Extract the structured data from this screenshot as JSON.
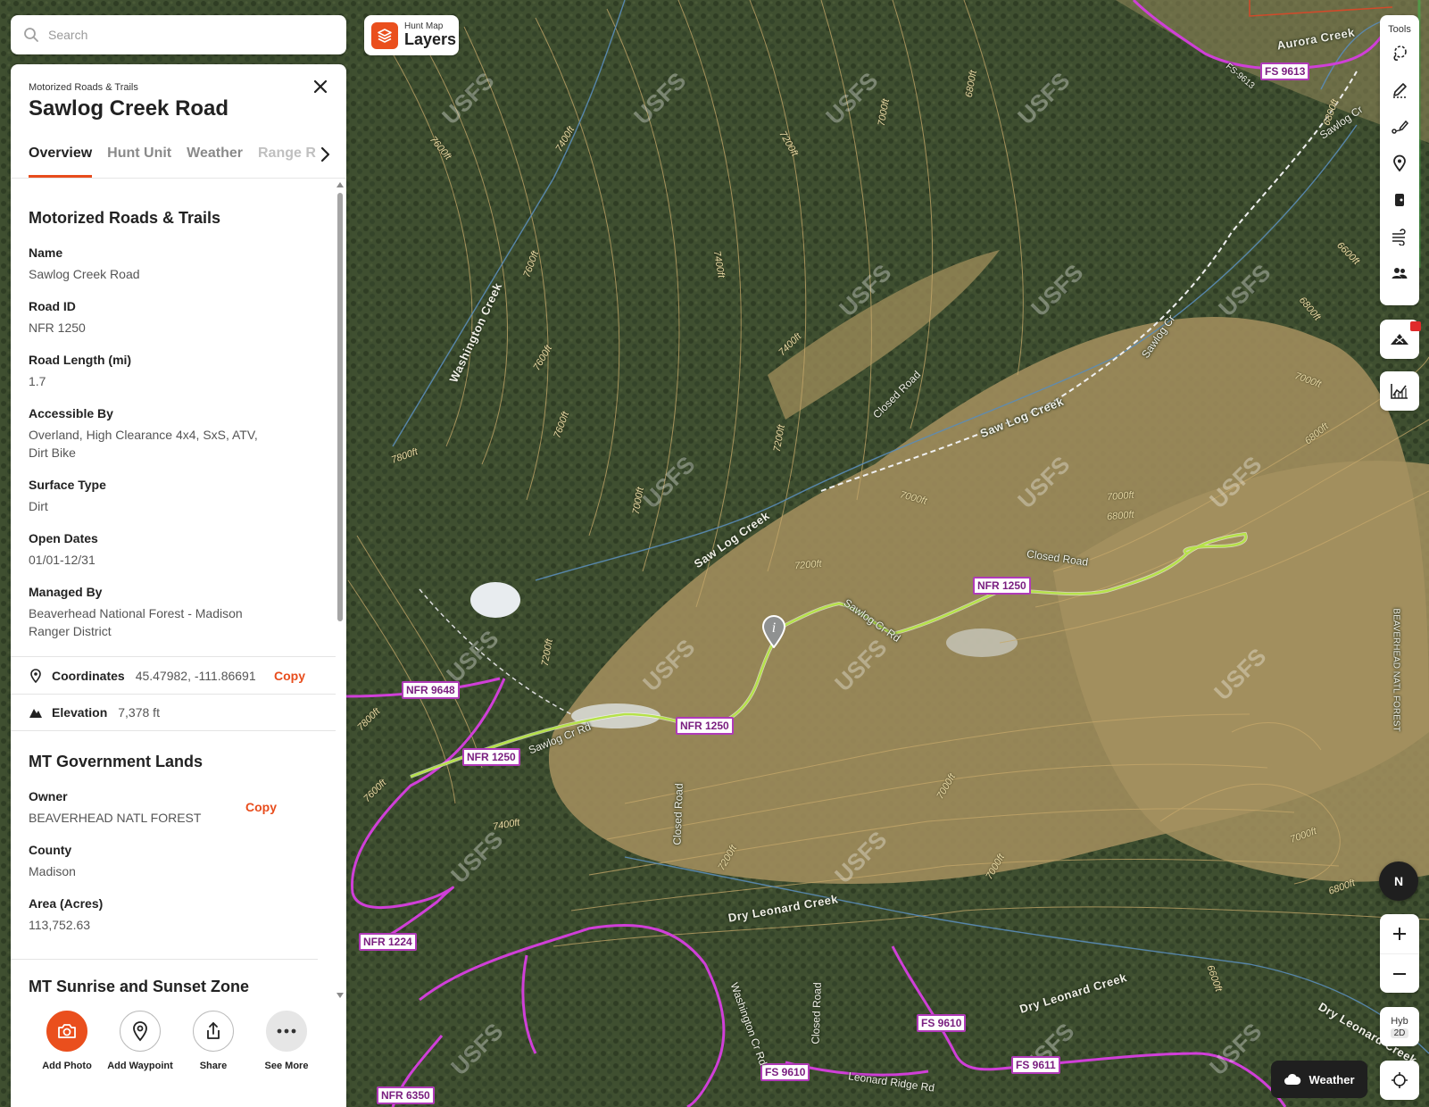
{
  "search": {
    "placeholder": "Search"
  },
  "layers": {
    "small": "Hunt Map",
    "label": "Layers"
  },
  "panel": {
    "subtitle": "Motorized Roads & Trails",
    "title": "Sawlog Creek Road",
    "tabs": [
      "Overview",
      "Hunt Unit",
      "Weather",
      "Range Rac"
    ],
    "section1_title": "Motorized Roads & Trails",
    "fields": [
      {
        "label": "Name",
        "value": "Sawlog Creek Road"
      },
      {
        "label": "Road ID",
        "value": "NFR 1250"
      },
      {
        "label": "Road Length (mi)",
        "value": "1.7"
      },
      {
        "label": "Accessible By",
        "value": "Overland, High Clearance 4x4, SxS, ATV, Dirt Bike"
      },
      {
        "label": "Surface Type",
        "value": "Dirt"
      },
      {
        "label": "Open Dates",
        "value": "01/01-12/31"
      },
      {
        "label": "Managed By",
        "value": "Beaverhead National Forest - Madison Ranger District"
      }
    ],
    "coordinates": {
      "label": "Coordinates",
      "value": "45.47982, -111.86691",
      "copy": "Copy"
    },
    "elevation": {
      "label": "Elevation",
      "value": "7,378 ft"
    },
    "section2_title": "MT Government Lands",
    "gov_fields": [
      {
        "label": "Owner",
        "value": "BEAVERHEAD NATL FOREST"
      },
      {
        "label": "County",
        "value": "Madison"
      },
      {
        "label": "Area (Acres)",
        "value": "113,752.63"
      }
    ],
    "owner_copy": "Copy",
    "section3_title": "MT Sunrise and Sunset Zone",
    "actions": [
      "Add Photo",
      "Add Waypoint",
      "Share",
      "See More"
    ]
  },
  "toolbar": {
    "label": "Tools",
    "tools": [
      "lasso-icon",
      "pencil-icon",
      "line-draw-icon",
      "pin-icon",
      "bookmark-icon",
      "wind-icon",
      "people-icon"
    ]
  },
  "compass": "N",
  "hyb": {
    "top": "Hyb",
    "bottom": "2D"
  },
  "weather_button": "Weather",
  "map": {
    "road_tags": [
      "FS 9613",
      "NFR 1250",
      "NFR 9648",
      "NFR 1250",
      "NFR 1250",
      "NFR 1224",
      "FS 9610",
      "FS 9610",
      "FS 9611",
      "NFR 6350"
    ],
    "names": [
      "Aurora Creek",
      "Sawlog Cr",
      "Sawlog Cr",
      "Saw Log Creek",
      "Saw Log Creek",
      "Closed Road",
      "Closed Road",
      "Sawlog Cr Rd",
      "Sawlog Cr Rd",
      "Washington Creek",
      "Closed Road",
      "Dry Leonard Creek",
      "Dry Leonard Creek",
      "Dry Leonard Creek",
      "Closed Road",
      "Washington Cr Rd",
      "Leonard Ridge Rd",
      "FS-9613",
      "BEAVERHEAD NATL FOREST"
    ],
    "contours": [
      "7600ft",
      "7400ft",
      "7200ft",
      "7000ft",
      "6800ft",
      "7600ft",
      "7800ft",
      "7600ft",
      "7400ft",
      "7200ft",
      "7000ft",
      "6800ft",
      "6600ft",
      "6800ft",
      "7000ft",
      "7200ft",
      "7000ft",
      "6800ft",
      "7000ft",
      "7400ft",
      "7600ft",
      "7800ft",
      "7200ft",
      "7000ft",
      "7000ft",
      "7000ft",
      "6800ft",
      "6600ft",
      "7600ft",
      "7400ft",
      "7200ft",
      "6800ft"
    ],
    "watermark": "USFS"
  }
}
